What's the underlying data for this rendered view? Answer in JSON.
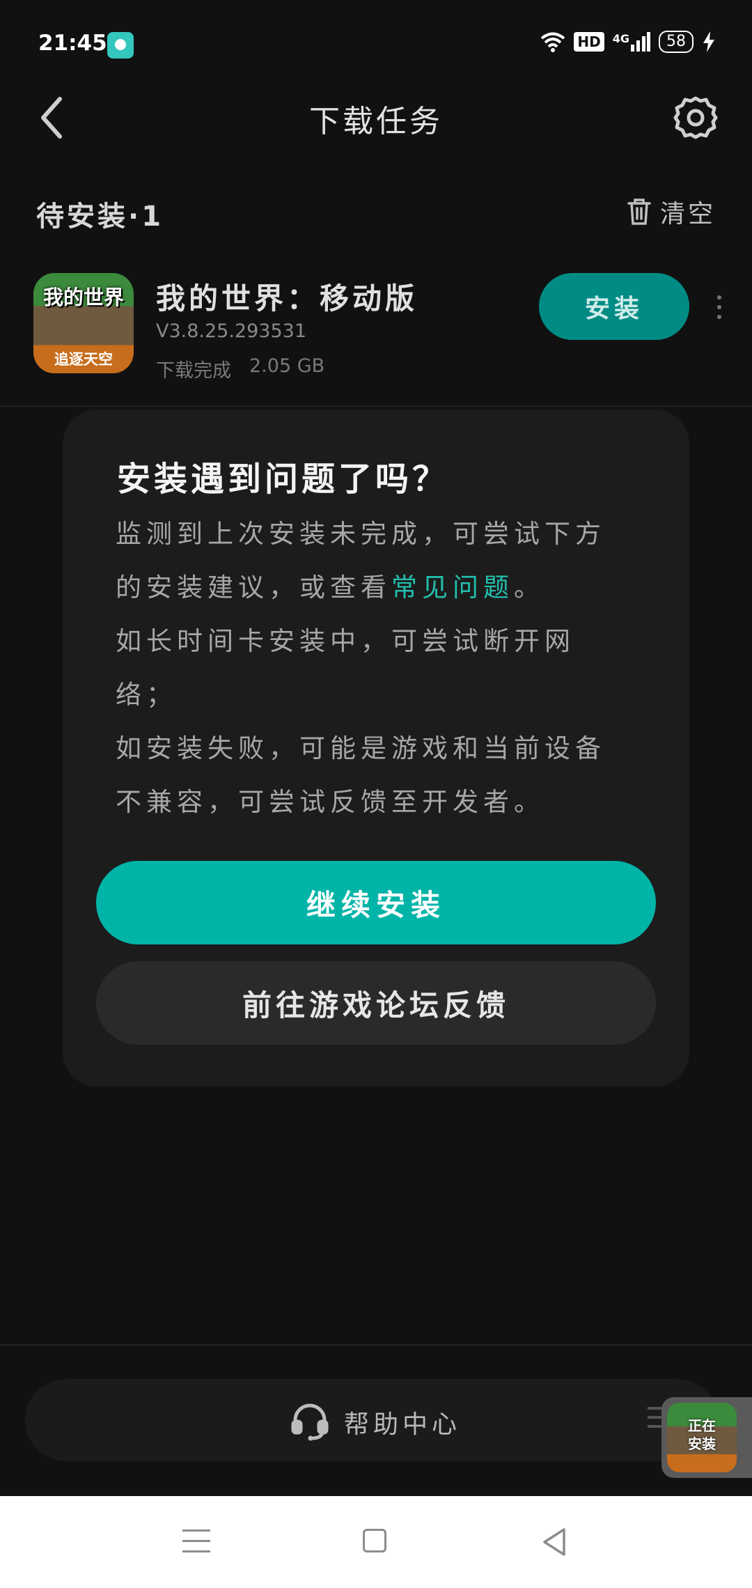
{
  "status_bar": {
    "time": "21:45",
    "hd": "HD",
    "network": "4G",
    "battery": "58",
    "icons": [
      "app-notification-icon",
      "wifi-icon",
      "hd-icon",
      "signal-4g-icon",
      "battery-icon",
      "charging-icon"
    ]
  },
  "header": {
    "title": "下载任务",
    "back_icon": "back-chevron-icon",
    "settings_icon": "gear-icon"
  },
  "pending": {
    "label": "待安装·1",
    "clear_label": "清空",
    "clear_icon": "trash-icon"
  },
  "game": {
    "icon_top_text": "我的世界",
    "icon_bottom_text": "追逐天空",
    "name": "我的世界：移动版",
    "version": "V3.8.25.293531",
    "status": "下载完成",
    "size": "2.05 GB",
    "install_label": "安装"
  },
  "dialog": {
    "title": "安装遇到问题了吗？",
    "body_part1": "监测到上次安装未完成，可尝试下方的安装建议，或查看",
    "link_text": "常见问题",
    "body_part2": "。",
    "body_line2": "如长时间卡安装中，可尝试断开网络；",
    "body_line3": "如安装失败，可能是游戏和当前设备不兼容，可尝试反馈至开发者。",
    "continue_label": "继续安装",
    "forum_label": "前往游戏论坛反馈"
  },
  "help": {
    "label": "帮助中心",
    "icon": "headset-icon"
  },
  "float_widget": {
    "line1": "正在",
    "line2": "安装"
  },
  "colors": {
    "accent": "#00b4a7",
    "install_button": "#008c85",
    "link": "#22bfae",
    "background": "#111111"
  }
}
